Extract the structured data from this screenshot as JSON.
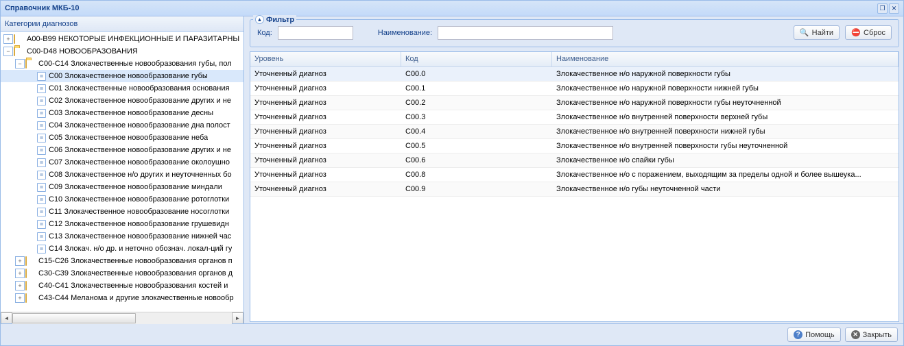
{
  "window": {
    "title": "Справочник МКБ-10"
  },
  "tree": {
    "header": "Категории диагнозов",
    "nodes": [
      {
        "indent": 0,
        "type": "folder",
        "toggle": "+",
        "label": "A00-B99 НЕКОТОРЫЕ ИНФЕКЦИОННЫЕ И ПАРАЗИТАРНЫ"
      },
      {
        "indent": 0,
        "type": "folder-open",
        "toggle": "−",
        "label": "C00-D48 НОВООБРАЗОВАНИЯ"
      },
      {
        "indent": 1,
        "type": "folder-open",
        "toggle": "−",
        "label": "C00-C14 Злокачественные новообразования губы, пол"
      },
      {
        "indent": 2,
        "type": "leaf",
        "label": "C00 Злокачественное новообразование губы",
        "selected": true
      },
      {
        "indent": 2,
        "type": "leaf",
        "label": "C01 Злокачественные новообразования основания"
      },
      {
        "indent": 2,
        "type": "leaf",
        "label": "C02 Злокачественное новообразование других и не"
      },
      {
        "indent": 2,
        "type": "leaf",
        "label": "C03 Злокачественное новообразование десны"
      },
      {
        "indent": 2,
        "type": "leaf",
        "label": "C04 Злокачественное новообразование дна полост"
      },
      {
        "indent": 2,
        "type": "leaf",
        "label": "C05 Злокачественное новообразование неба"
      },
      {
        "indent": 2,
        "type": "leaf",
        "label": "C06 Злокачественное новообразование других и не"
      },
      {
        "indent": 2,
        "type": "leaf",
        "label": "C07 Злокачественное новообразование околоушно"
      },
      {
        "indent": 2,
        "type": "leaf",
        "label": "C08 Злокачественное н/о других и неуточненных бо"
      },
      {
        "indent": 2,
        "type": "leaf",
        "label": "C09 Злокачественное новообразование миндали"
      },
      {
        "indent": 2,
        "type": "leaf",
        "label": "C10 Злокачественное новообразование ротоглотки"
      },
      {
        "indent": 2,
        "type": "leaf",
        "label": "C11 Злокачественное новообразование носоглотки"
      },
      {
        "indent": 2,
        "type": "leaf",
        "label": "C12 Злокачественное новообразование грушевидн"
      },
      {
        "indent": 2,
        "type": "leaf",
        "label": "C13 Злокачественное новообразование нижней час"
      },
      {
        "indent": 2,
        "type": "leaf",
        "label": "C14 Злокач. н/о др. и неточно обознач. локал-ций гу"
      },
      {
        "indent": 1,
        "type": "folder",
        "toggle": "+",
        "label": "C15-C26 Злокачественные новообразования органов п"
      },
      {
        "indent": 1,
        "type": "folder",
        "toggle": "+",
        "label": "C30-C39 Злокачественные новообразования органов д"
      },
      {
        "indent": 1,
        "type": "folder",
        "toggle": "+",
        "label": "C40-C41 Злокачественные новообразования костей и"
      },
      {
        "indent": 1,
        "type": "folder",
        "toggle": "+",
        "label": "C43-C44 Меланома и другие злокачественные новообр"
      }
    ]
  },
  "filter": {
    "legend": "Фильтр",
    "code_label": "Код:",
    "name_label": "Наименование:",
    "search_btn": "Найти",
    "reset_btn": "Сброс"
  },
  "grid": {
    "headers": {
      "level": "Уровень",
      "code": "Код",
      "name": "Наименование"
    },
    "rows": [
      {
        "level": "Уточненный диагноз",
        "code": "C00.0",
        "name": "Злокачественное н/о наружной поверхности губы"
      },
      {
        "level": "Уточненный диагноз",
        "code": "C00.1",
        "name": "Злокачественное н/о наружной поверхности нижней губы"
      },
      {
        "level": "Уточненный диагноз",
        "code": "C00.2",
        "name": "Злокачественное н/о наружной поверхности губы неуточненной"
      },
      {
        "level": "Уточненный диагноз",
        "code": "C00.3",
        "name": "Злокачественное н/о внутренней поверхности верхней губы"
      },
      {
        "level": "Уточненный диагноз",
        "code": "C00.4",
        "name": "Злокачественное н/о внутренней поверхности нижней губы"
      },
      {
        "level": "Уточненный диагноз",
        "code": "C00.5",
        "name": "Злокачественное н/о внутренней поверхности губы неуточненной"
      },
      {
        "level": "Уточненный диагноз",
        "code": "C00.6",
        "name": "Злокачественное н/о спайки губы"
      },
      {
        "level": "Уточненный диагноз",
        "code": "C00.8",
        "name": "Злокачественное н/о с поражением, выходящим за пределы одной и более вышеука..."
      },
      {
        "level": "Уточненный диагноз",
        "code": "C00.9",
        "name": "Злокачественное н/о губы неуточненной части"
      }
    ]
  },
  "footer": {
    "help": "Помощь",
    "close": "Закрыть"
  }
}
